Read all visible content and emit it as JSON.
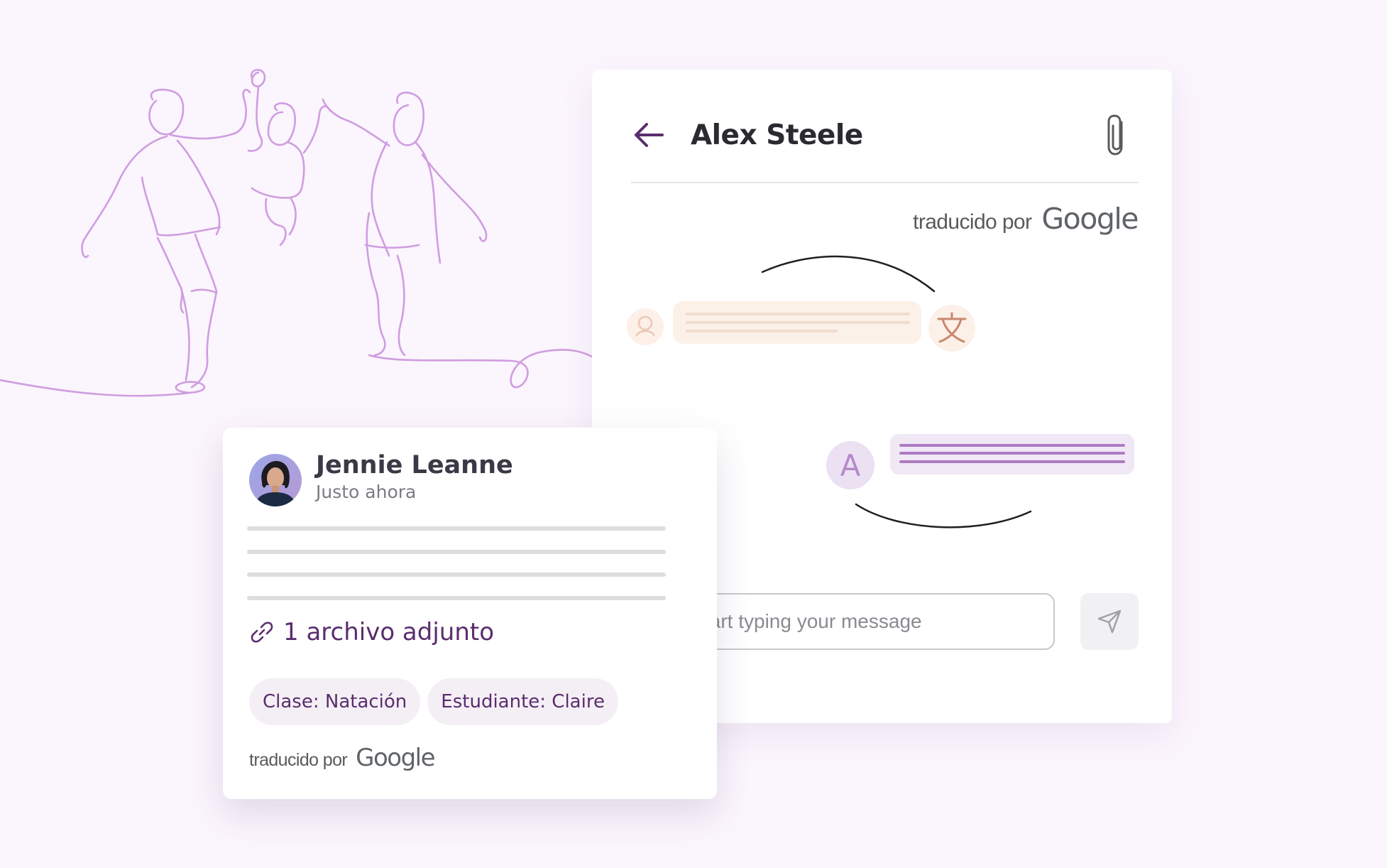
{
  "theme": {
    "accent": "#5a2d6e",
    "illustration_line": "#cf9de0",
    "background": "#fbf5fd"
  },
  "chat": {
    "contact_name": "Alex Steele",
    "translated_by_label": "traducido por",
    "translated_by_brand": "Google",
    "input_placeholder": "tart typing your message",
    "reply_avatar_letter": "A",
    "icons": {
      "back": "arrow-left-icon",
      "attach": "paperclip-icon",
      "send": "send-icon",
      "translate": "translate-icon",
      "user": "user-icon"
    }
  },
  "message_card": {
    "sender_name": "Jennie Leanne",
    "timestamp": "Justo ahora",
    "attachment_label": "1 archivo adjunto",
    "tags": [
      "Clase: Natación",
      "Estudiante: Claire"
    ],
    "translated_by_label": "traducido por",
    "translated_by_brand": "Google",
    "icons": {
      "attachment": "link-icon"
    }
  }
}
